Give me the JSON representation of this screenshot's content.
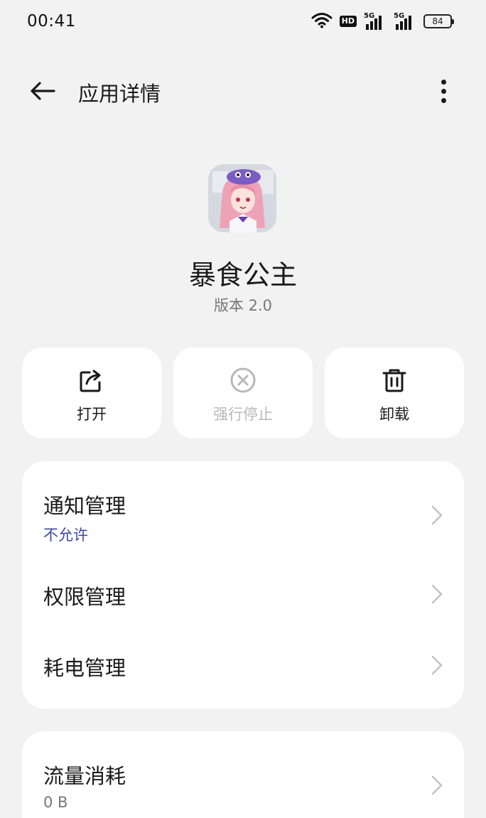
{
  "status_bar": {
    "time": "00:41",
    "hd_label": "HD",
    "signal_1": "5G",
    "signal_2": "5G",
    "battery": "84"
  },
  "header": {
    "title": "应用详情"
  },
  "app": {
    "name": "暴食公主",
    "version": "版本 2.0"
  },
  "actions": {
    "open": "打开",
    "force_stop": "强行停止",
    "uninstall": "卸载"
  },
  "settings": {
    "notification": {
      "title": "通知管理",
      "value": "不允许"
    },
    "permissions": {
      "title": "权限管理"
    },
    "battery": {
      "title": "耗电管理"
    }
  },
  "data_usage": {
    "title": "流量消耗",
    "value": "0 B"
  },
  "colors": {
    "background": "#f2f2f2",
    "card": "#ffffff",
    "accent_value": "#3b4a9e",
    "disabled": "#b8b8b8",
    "secondary": "#777777"
  }
}
